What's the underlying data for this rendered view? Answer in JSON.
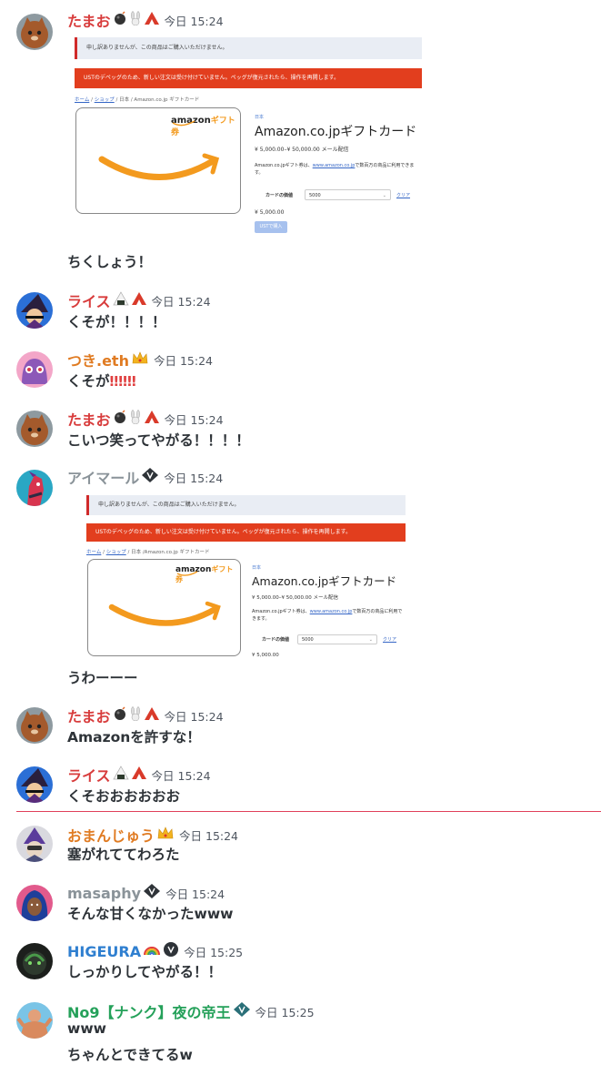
{
  "messages": [
    {
      "user": "たまお",
      "color": "#d83c3c",
      "time": "今日 15:24",
      "badges": [
        "bomb-icon",
        "bunny-icon",
        "apex-icon"
      ]
    },
    {
      "text": "ちくしょう！"
    },
    {
      "user": "ライス",
      "color": "#d83c3c",
      "time": "今日 15:24",
      "badges": [
        "onigiri-icon",
        "apex-icon"
      ],
      "text": "くそが！！！！"
    },
    {
      "user": "つき.eth",
      "color": "#e07b22",
      "time": "今日 15:24",
      "badges": [
        "crown-icon"
      ],
      "text": "くそが",
      "emph": "‼‼‼"
    },
    {
      "user": "たまお",
      "color": "#d83c3c",
      "time": "今日 15:24",
      "badges": [
        "bomb-icon",
        "bunny-icon",
        "apex-icon"
      ],
      "text": "こいつ笑ってやがる！！！！"
    },
    {
      "user": "アイマール",
      "color": "#8a9399",
      "time": "今日 15:24",
      "badges": [
        "valorant-diamond-icon"
      ],
      "text": "うわーーー"
    },
    {
      "user": "たまお",
      "color": "#d83c3c",
      "time": "今日 15:24",
      "badges": [
        "bomb-icon",
        "bunny-icon",
        "apex-icon"
      ],
      "text": "Amazonを許すな！"
    },
    {
      "user": "ライス",
      "color": "#d83c3c",
      "time": "今日 15:24",
      "badges": [
        "onigiri-icon",
        "apex-icon"
      ],
      "text": "くそおおおおおお"
    },
    {
      "user": "おまんじゅう",
      "color": "#e07b22",
      "time": "今日 15:24",
      "badges": [
        "crown-icon"
      ],
      "text": "塞がれててわろた"
    },
    {
      "user": "masaphy",
      "color": "#8a9399",
      "time": "今日 15:24",
      "badges": [
        "valorant-diamond-icon"
      ],
      "text": "そんな甘くなかったwww"
    },
    {
      "user": "HIGEURA",
      "color": "#2f7fd0",
      "time": "今日 15:25",
      "badges": [
        "rainbow-icon",
        "shield-icon"
      ],
      "text": "しっかりしてやがる！！"
    },
    {
      "user": "No9【ナンク】夜の帝王",
      "color": "#25a15a",
      "time": "今日 15:25",
      "badges": [
        "valorant-diamond-icon"
      ],
      "text": "www",
      "text2": "ちゃんとできてるw"
    }
  ],
  "shot": {
    "notice": "申し訳ありませんが、この商品はご購入いただけません。",
    "alert": "USTのデペッグのため、新しい注文は受け付けていません。ペッグが復元されたら、操作を再開します。",
    "crumb_home": "ホーム",
    "crumb_shop": "ショップ",
    "crumb_rest": "日本 / Amazon.co.jp ギフトカード",
    "crumb_rest2": "日本 /Amazon.co.jp ギフトカード",
    "logo_word": "amazon",
    "logo_jp": "ギフト券",
    "region": "日本",
    "title": "Amazon.co.jpギフトカード",
    "price_range": "¥ 5,000.00–¥ 50,000.00",
    "price_note": "メール配信",
    "desc_a": "Amazon.co.jpギフト券は、",
    "desc_link": "www.amazon.co.jp",
    "desc_b": "で数百万の商品に利用できます。",
    "field_label": "カードの価値",
    "select_value": "5000",
    "clear": "クリア",
    "total": "¥ 5,000.00",
    "buy": "USTで購入"
  }
}
